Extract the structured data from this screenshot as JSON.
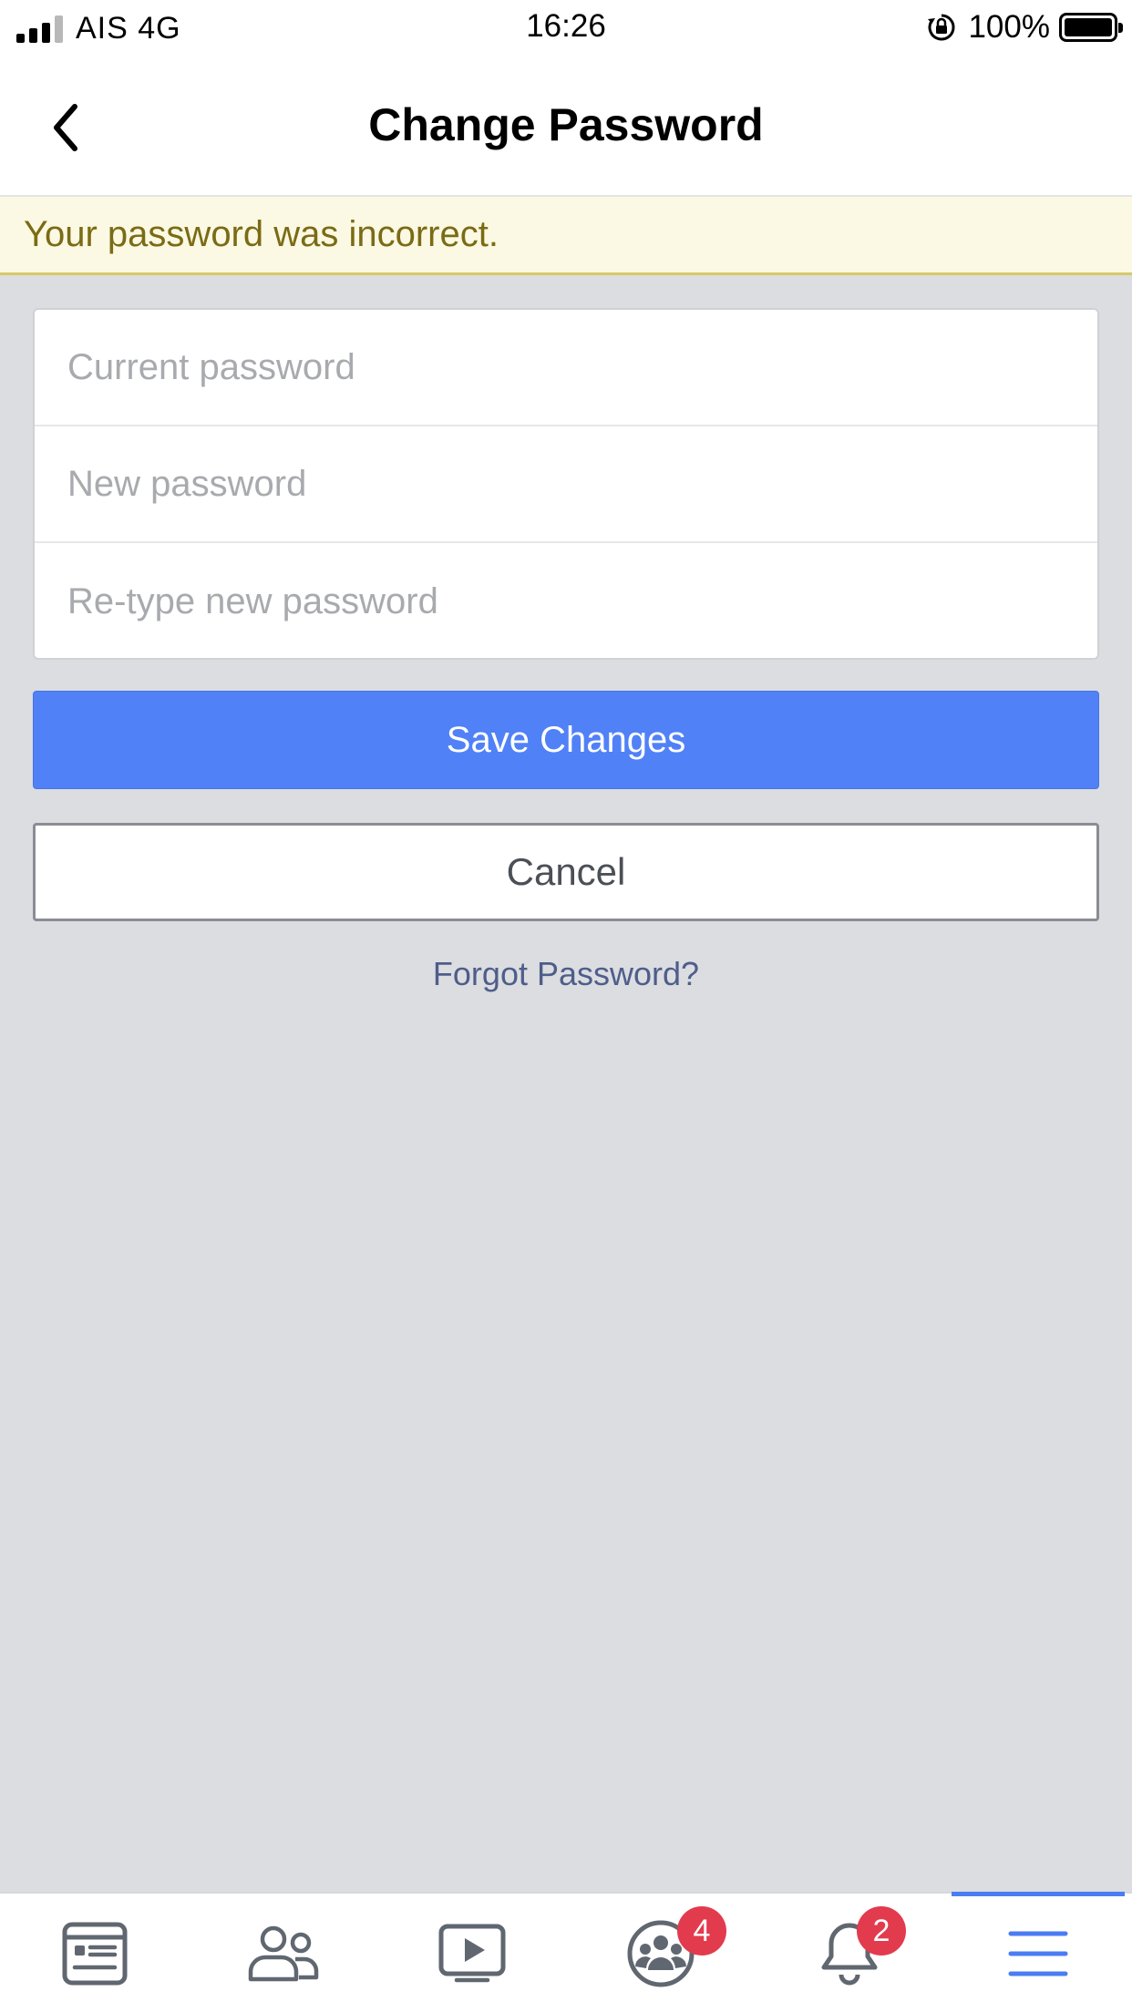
{
  "status_bar": {
    "carrier": "AIS 4G",
    "time": "16:26",
    "battery": "100%"
  },
  "nav": {
    "title": "Change Password"
  },
  "error": {
    "message": "Your password was incorrect."
  },
  "form": {
    "current_placeholder": "Current password",
    "new_placeholder": "New password",
    "retype_placeholder": "Re-type new password"
  },
  "actions": {
    "save_label": "Save Changes",
    "cancel_label": "Cancel",
    "forgot_label": "Forgot Password?"
  },
  "tabs": {
    "items": [
      "news-feed-icon",
      "friends-icon",
      "watch-icon",
      "groups-icon",
      "notifications-icon",
      "menu-icon"
    ],
    "groups_badge": "4",
    "notifications_badge": "2",
    "active": "menu"
  },
  "colors": {
    "primary": "#5181f7",
    "error_bg": "#fbf9e3",
    "error_text": "#7a6b15",
    "badge": "#e23b4e",
    "active_tab": "#4a7cf3"
  }
}
